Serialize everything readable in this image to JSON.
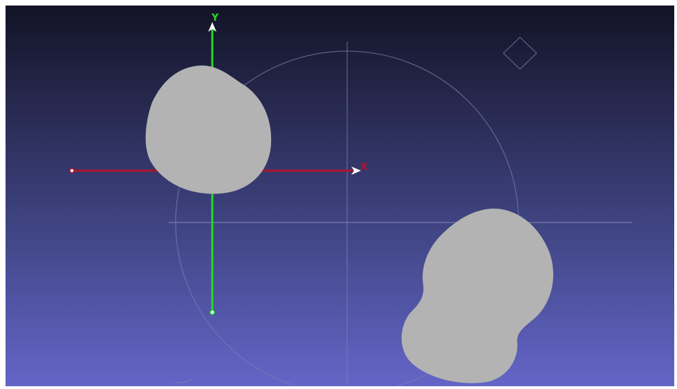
{
  "viewer": {
    "background_top": "#121326",
    "background_bottom": "#6465c7",
    "mesh_color": "#b3b3b3",
    "trackball_color": "#7a7ca8"
  },
  "axes": {
    "x_label": "X",
    "y_label": "Y",
    "x_color": "#b0132a",
    "y_color": "#22dd22"
  }
}
